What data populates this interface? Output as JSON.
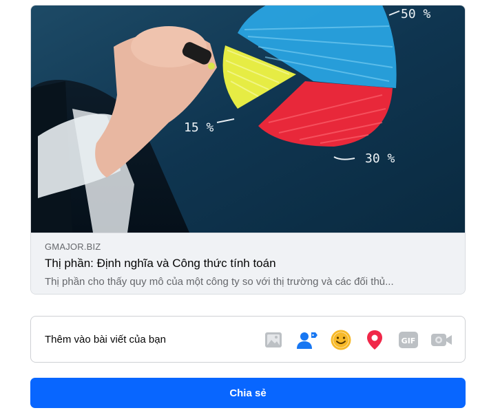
{
  "link_preview": {
    "image_labels": {
      "pie_50": "50 %",
      "pie_15": "15 %",
      "pie_30": "30 %"
    },
    "domain": "GMAJOR.BIZ",
    "title": "Thị phần: Định nghĩa và Công thức tính toán",
    "description": "Thị phần cho thấy quy mô của một công ty so với thị trường và các đối thủ..."
  },
  "add_to_post": {
    "label": "Thêm vào bài viết của bạn",
    "icons": [
      "photo-icon",
      "tag-people-icon",
      "feeling-icon",
      "location-icon",
      "gif-icon",
      "live-video-icon"
    ]
  },
  "share_button": {
    "label": "Chia sẻ"
  },
  "colors": {
    "primary": "#0866ff",
    "icon_disabled": "#bcc0c4",
    "tag_blue": "#1877f2",
    "feeling_yellow": "#f7b928",
    "location_red": "#f02849"
  }
}
